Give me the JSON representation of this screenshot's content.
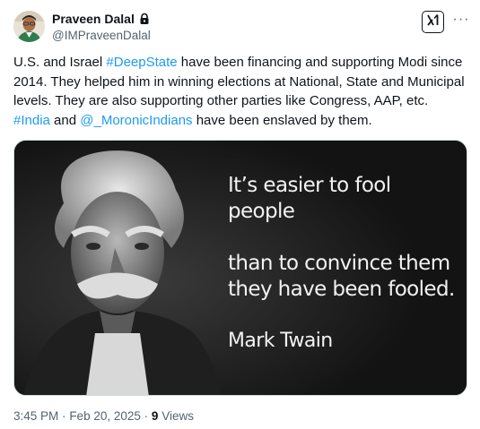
{
  "author": {
    "display_name": "Praveen Dalal",
    "handle": "@IMPraveenDalal",
    "protected_icon": "lock-icon",
    "avatar_icon": "avatar"
  },
  "actions": {
    "grok_icon": "grok-icon",
    "more_icon": "more-icon",
    "more_label": "···"
  },
  "tweet": {
    "segments": [
      {
        "text": "U.S. and Israel ",
        "link": false
      },
      {
        "text": "#DeepState",
        "link": true
      },
      {
        "text": " have been financing and supporting Modi since 2014. They helped him in winning elections at National, State and Municipal levels. They are also supporting other parties like Congress, AAP, etc. ",
        "link": false
      },
      {
        "text": "#India",
        "link": true
      },
      {
        "text": " and ",
        "link": false
      },
      {
        "text": "@_MoronicIndians",
        "link": true
      },
      {
        "text": " have been enslaved by them.",
        "link": false
      }
    ]
  },
  "media": {
    "quote_line1": "It’s easier to fool people",
    "quote_line2": "than to convince them they have been fooled.",
    "author": "Mark Twain"
  },
  "meta": {
    "time": "3:45 PM",
    "separator": "·",
    "date": "Feb 20, 2025",
    "views_count": "9",
    "views_label": "Views"
  },
  "colors": {
    "link": "#1d9bf0",
    "secondary_text": "#536471",
    "primary_text": "#0f1419"
  }
}
